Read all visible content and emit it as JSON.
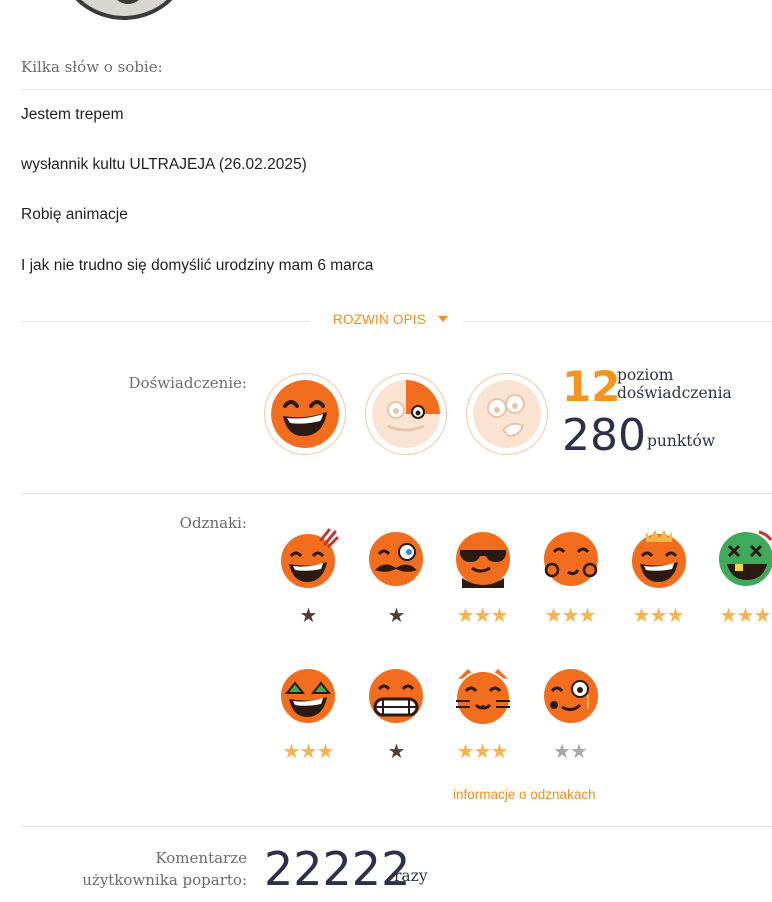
{
  "about": {
    "title": "Kilka słów o sobie:",
    "lines": [
      "Jestem trepem",
      "wysłannik kultu ULTRAJEJA (26.02.2025)",
      "Robię animacje",
      "I jak nie trudno się domyślić urodziny mam 6 marca"
    ],
    "expand_label": "ROZWIŃ OPIS"
  },
  "experience": {
    "label": "Doświadczenie:",
    "level": "12",
    "level_text_1": "poziom",
    "level_text_2": "doświadczenia",
    "points": "280",
    "points_text": "punktów",
    "level_icons": [
      "laughing-face-full",
      "face-partial",
      "face-empty"
    ]
  },
  "badges": {
    "label": "Odznaki:",
    "info_link": "informacje o odznakach",
    "colors": {
      "orange": "#f26d1d",
      "gold_star": "#f7b44b",
      "brown_star": "#5a3a2e",
      "gray_star": "#a8a8a8",
      "green": "#3eaa5a"
    },
    "items": [
      {
        "name": "laughing-scratched",
        "stars": "★",
        "star_color": "#5a3a2e"
      },
      {
        "name": "mustache-monocle",
        "stars": "★",
        "star_color": "#5a3a2e"
      },
      {
        "name": "sunglasses-tuxedo",
        "stars": "★★★",
        "star_color": "#f7b44b"
      },
      {
        "name": "money-eyes",
        "stars": "★★★",
        "star_color": "#f7b44b"
      },
      {
        "name": "crown",
        "stars": "★★★",
        "star_color": "#f7b44b"
      },
      {
        "name": "zombie",
        "stars": "★★★",
        "star_color": "#f7b44b"
      },
      {
        "name": "green-eyes",
        "stars": "★★★",
        "star_color": "#f7b44b"
      },
      {
        "name": "grin-teeth",
        "stars": "★",
        "star_color": "#5a3a2e"
      },
      {
        "name": "cat",
        "stars": "★★★",
        "star_color": "#f7b44b"
      },
      {
        "name": "monocle-smirk",
        "stars": "★★",
        "star_color": "#a8a8a8"
      }
    ]
  },
  "comments": {
    "label_1": "Komentarze",
    "label_2": "użytkownika poparto:",
    "count": "22222",
    "unit": "razy"
  }
}
